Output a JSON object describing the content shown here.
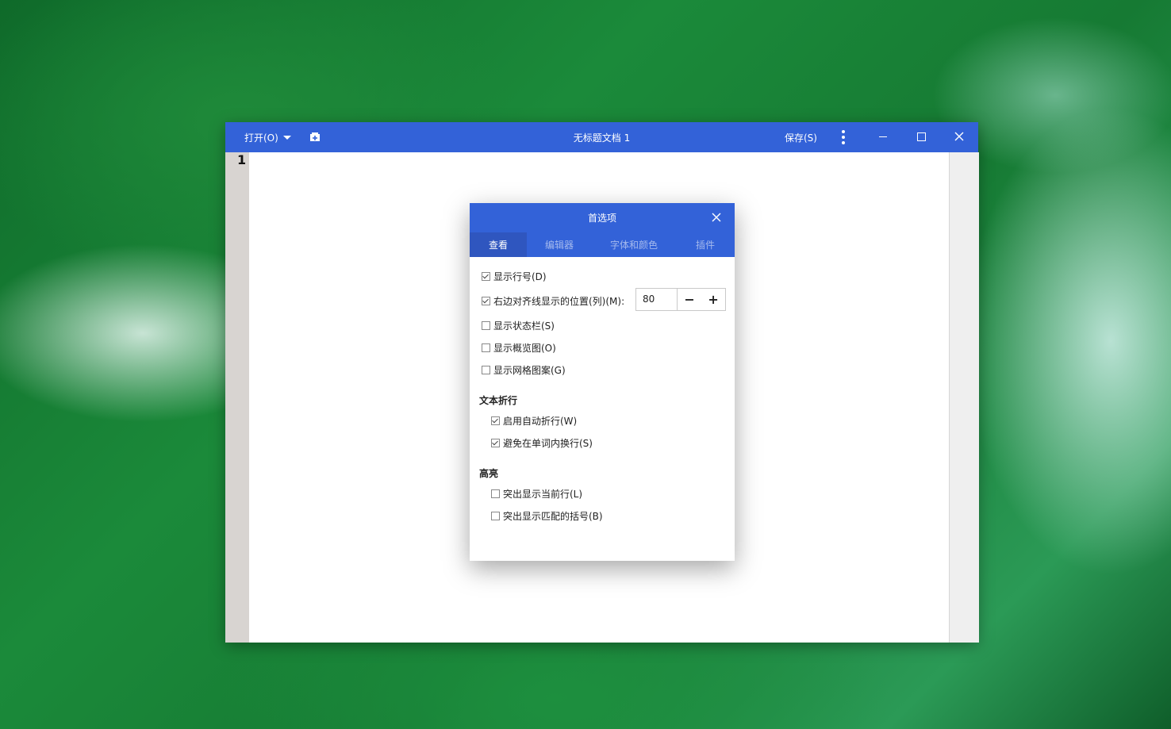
{
  "window": {
    "open_label": "打开(O)",
    "title": "无标题文档 1",
    "save_label": "保存(S)",
    "line_number": "1"
  },
  "dialog": {
    "title": "首选项",
    "tabs": [
      "查看",
      "编辑器",
      "字体和颜色",
      "插件"
    ],
    "options": {
      "show_line_numbers": {
        "label": "显示行号(D)",
        "checked": true
      },
      "right_margin": {
        "label": "右边对齐线显示的位置(列)(M):",
        "checked": true,
        "value": "80"
      },
      "show_statusbar": {
        "label": "显示状态栏(S)",
        "checked": false
      },
      "show_overview": {
        "label": "显示概览图(O)",
        "checked": false
      },
      "show_grid": {
        "label": "显示网格图案(G)",
        "checked": false
      }
    },
    "wrap_section": "文本折行",
    "wrap": {
      "enable_wrap": {
        "label": "启用自动折行(W)",
        "checked": true
      },
      "no_split_words": {
        "label": "避免在单词内换行(S)",
        "checked": true
      }
    },
    "highlight_section": "高亮",
    "highlight": {
      "current_line": {
        "label": "突出显示当前行(L)",
        "checked": false
      },
      "matching_brackets": {
        "label": "突出显示匹配的括号(B)",
        "checked": false
      }
    },
    "stepper_minus": "−",
    "stepper_plus": "+"
  },
  "colors": {
    "titlebar": "#3362d8",
    "active_tab": "#2f56bf"
  }
}
